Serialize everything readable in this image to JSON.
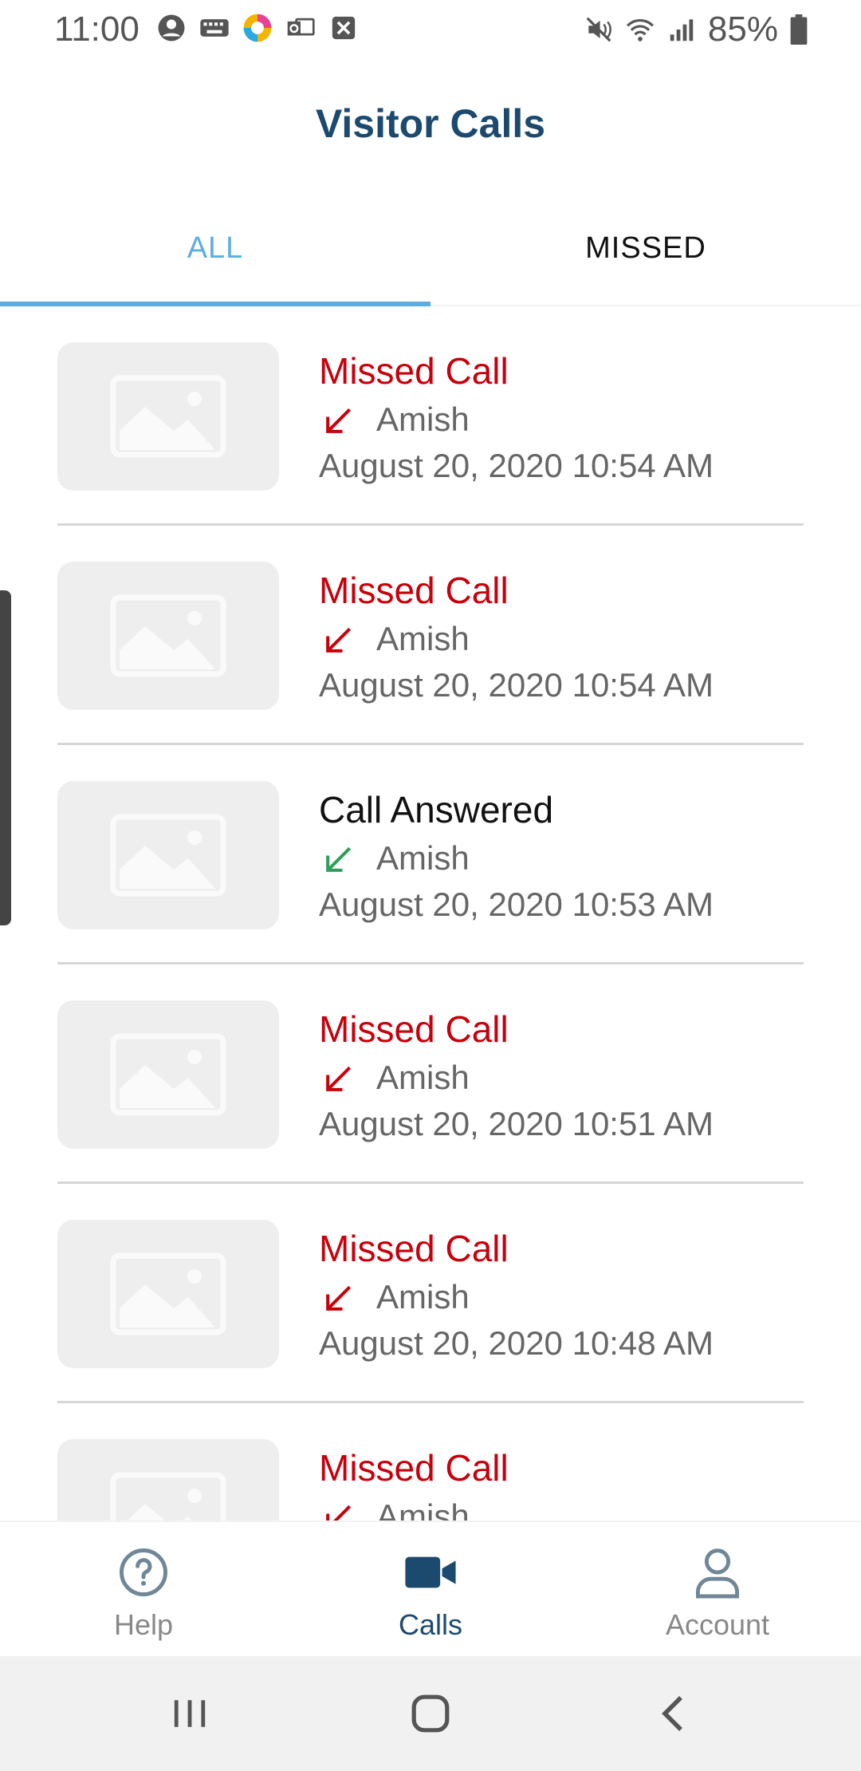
{
  "status_bar": {
    "time": "11:00",
    "battery": "85%"
  },
  "header": {
    "title": "Visitor Calls"
  },
  "tabs": [
    {
      "label": "ALL",
      "active": true
    },
    {
      "label": "MISSED",
      "active": false
    }
  ],
  "calls": [
    {
      "status": "Missed Call",
      "type": "missed",
      "name": "Amish",
      "datetime": "August 20, 2020 10:54 AM"
    },
    {
      "status": "Missed Call",
      "type": "missed",
      "name": "Amish",
      "datetime": "August 20, 2020 10:54 AM"
    },
    {
      "status": "Call Answered",
      "type": "answered",
      "name": "Amish",
      "datetime": "August 20, 2020 10:53 AM"
    },
    {
      "status": "Missed Call",
      "type": "missed",
      "name": "Amish",
      "datetime": "August 20, 2020 10:51 AM"
    },
    {
      "status": "Missed Call",
      "type": "missed",
      "name": "Amish",
      "datetime": "August 20, 2020 10:48 AM"
    },
    {
      "status": "Missed Call",
      "type": "missed",
      "name": "Amish",
      "datetime": ""
    }
  ],
  "bottom_nav": [
    {
      "label": "Help",
      "icon": "help-circle-icon",
      "active": false
    },
    {
      "label": "Calls",
      "icon": "video-camera-icon",
      "active": true
    },
    {
      "label": "Account",
      "icon": "person-icon",
      "active": false
    }
  ],
  "colors": {
    "accent": "#5aaee0",
    "title": "#1c4a6e",
    "missed": "#c8000b",
    "answered_arrow": "#2e9e5b"
  }
}
